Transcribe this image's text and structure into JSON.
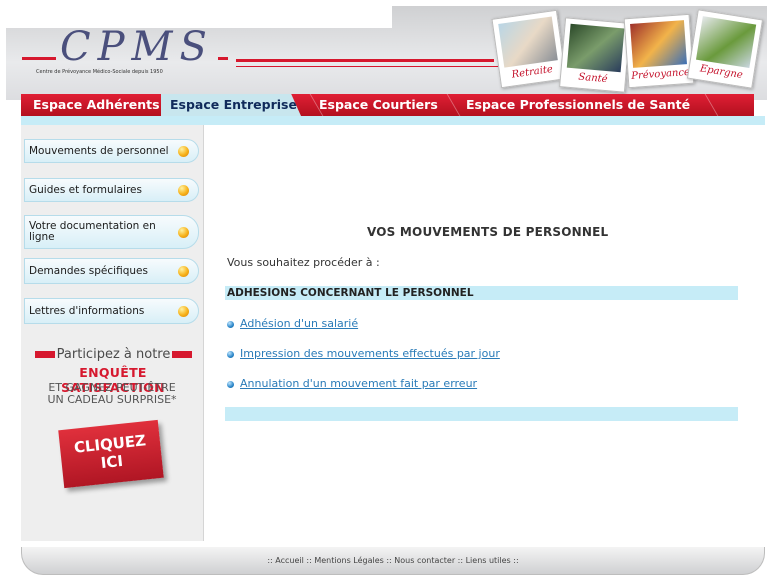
{
  "header": {
    "logo_text": "CPMS",
    "logo_tagline": "Centre de Prévoyance Médico-Sociale depuis 1950",
    "polaroids": [
      {
        "caption": "Retraite"
      },
      {
        "caption": "Santé"
      },
      {
        "caption": "Prévoyance"
      },
      {
        "caption": "Epargne"
      }
    ]
  },
  "tabs": [
    {
      "label": "Espace Adhérents"
    },
    {
      "label": "Espace Entreprises",
      "active": true
    },
    {
      "label": "Espace Courtiers"
    },
    {
      "label": "Espace Professionnels de Santé"
    }
  ],
  "sidebar": {
    "items": [
      {
        "label": "Mouvements de personnel"
      },
      {
        "label": "Guides et formulaires"
      },
      {
        "label": "Votre documentation en ligne"
      },
      {
        "label": "Demandes spécifiques"
      },
      {
        "label": "Lettres d'informations"
      }
    ],
    "promo": {
      "line1": "Participez à notre",
      "line2": "ENQUÊTE SATISFACTION",
      "line3a": "ET GAGNEZ PEUT-ÊTRE",
      "line3b": "UN CADEAU SURPRISE*",
      "button_line1": "CLIQUEZ",
      "button_line2": "ICI"
    }
  },
  "main": {
    "title": "VOS MOUVEMENTS DE PERSONNEL",
    "intro": "Vous souhaitez procéder à :",
    "section_title": "ADHESIONS CONCERNANT LE PERSONNEL",
    "links": [
      {
        "label": "Adhésion d'un salarié"
      },
      {
        "label": "Impression des mouvements effectués par jour"
      },
      {
        "label": "Annulation d'un mouvement fait par erreur"
      }
    ]
  },
  "footer": {
    "prefix": ":: ",
    "accueil": "Accueil",
    "mentions": "Mentions Légales",
    "contact": "Nous contacter",
    "liens": "Liens utiles",
    "sep": " :: ",
    "suffix": " ::"
  },
  "colors": {
    "brand_red": "#d6182e",
    "accent_light_blue": "#c6ecf7",
    "link_blue": "#2a7bb8",
    "logo_blue": "#4a4f7c"
  },
  "icons": {
    "sidebar_bullet": "orange-dot-icon",
    "link_bullet": "blue-dot-icon"
  }
}
